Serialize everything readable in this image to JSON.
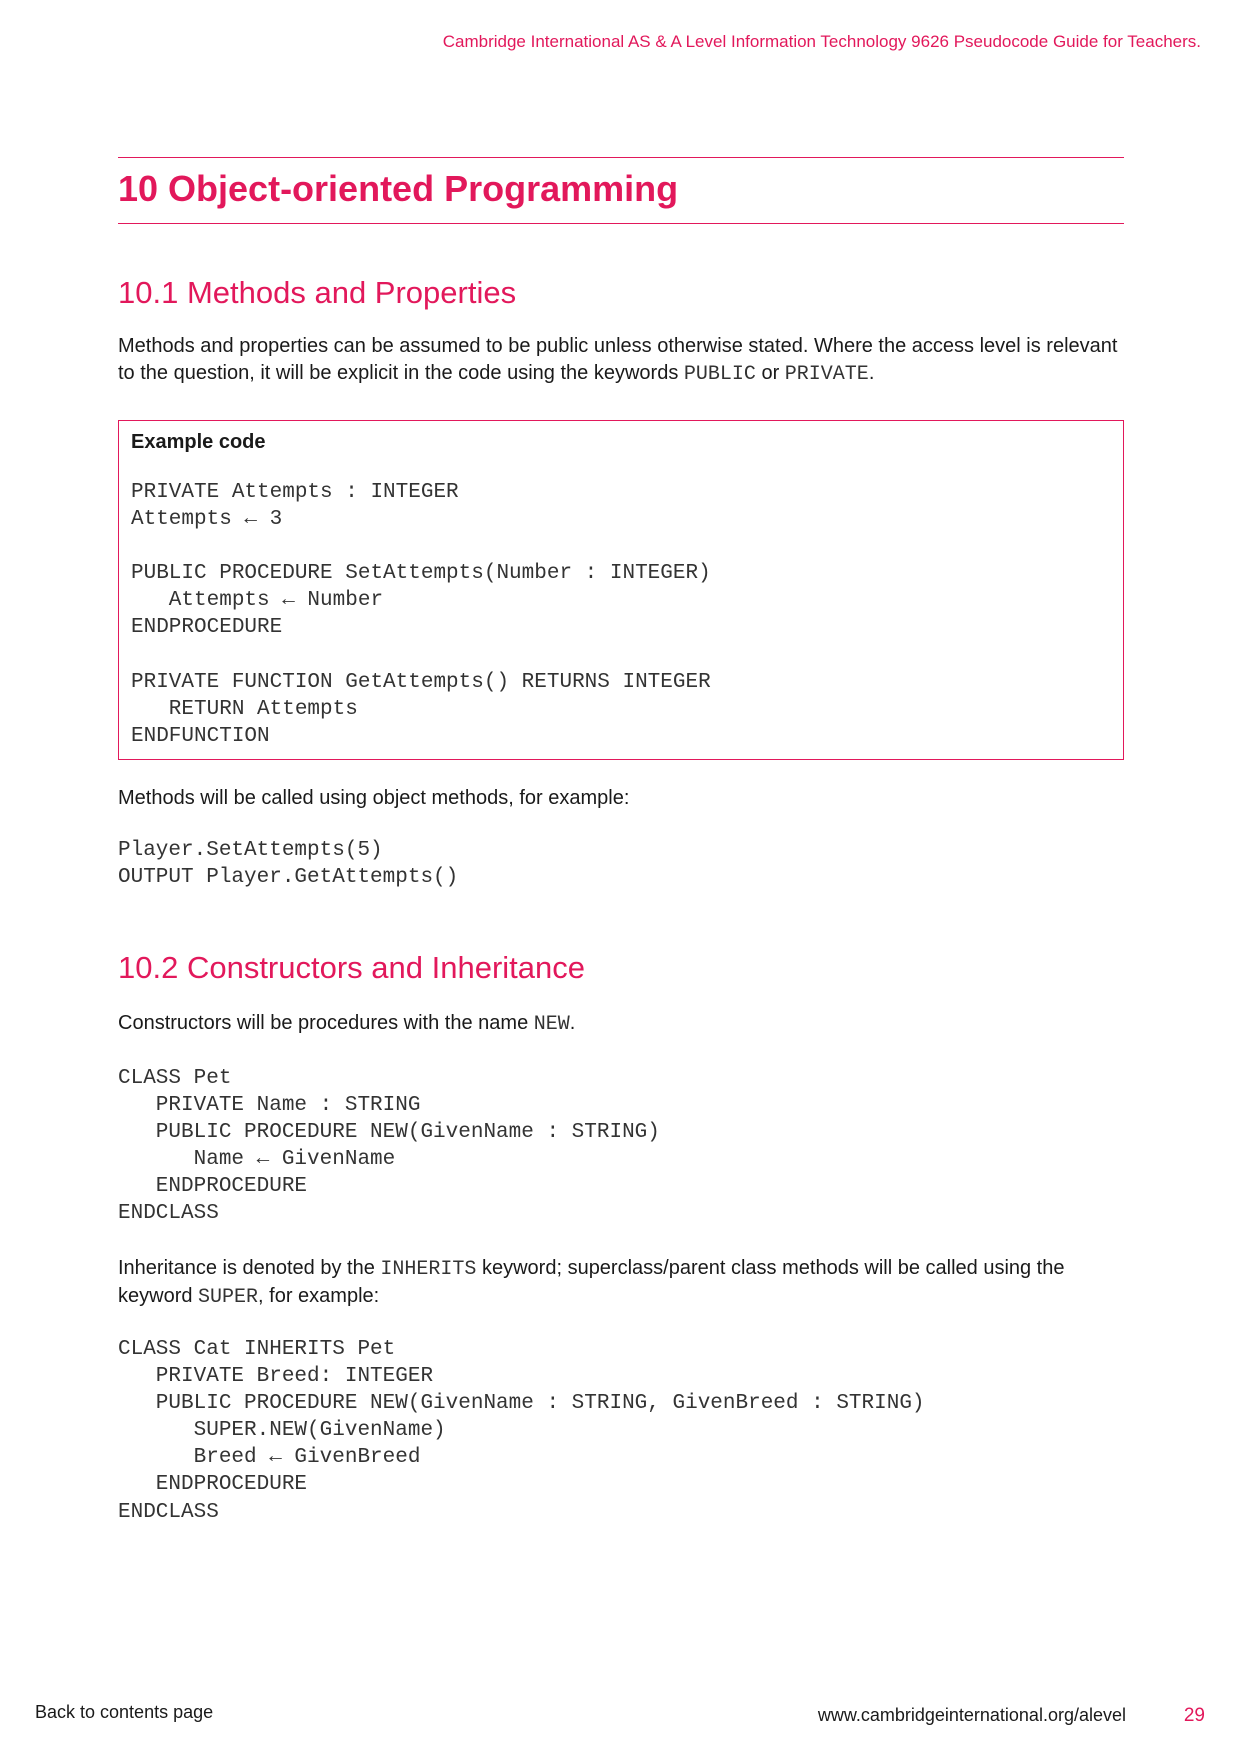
{
  "header": {
    "running_title": "Cambridge International AS & A Level Information Technology 9626 Pseudocode Guide for Teachers."
  },
  "chapter": {
    "title": "10  Object-oriented Programming"
  },
  "section_10_1": {
    "title": "10.1  Methods and Properties",
    "intro_text": "Methods and properties can be assumed to be public unless otherwise stated. Where the access level is relevant to the question, it will be explicit in the code using the keywords ",
    "kw_public": "PUBLIC",
    "text_or": " or ",
    "kw_private": "PRIVATE",
    "text_period": ".",
    "example_box": {
      "title": "Example code",
      "code": "PRIVATE Attempts : INTEGER\nAttempts ← 3\n\nPUBLIC PROCEDURE SetAttempts(Number : INTEGER)\n   Attempts ← Number\nENDPROCEDURE\n\nPRIVATE FUNCTION GetAttempts() RETURNS INTEGER\n   RETURN Attempts\nENDFUNCTION"
    },
    "call_text": "Methods will be called using object methods, for example:",
    "call_code": "Player.SetAttempts(5)\nOUTPUT Player.GetAttempts()"
  },
  "section_10_2": {
    "title": "10.2  Constructors and Inheritance",
    "constructor_text": "Constructors will be procedures with the name ",
    "kw_new": "NEW",
    "constructor_end": ".",
    "pet_code": "CLASS Pet\n   PRIVATE Name : STRING\n   PUBLIC PROCEDURE NEW(GivenName : STRING)\n      Name ← GivenName\n   ENDPROCEDURE\nENDCLASS",
    "inherit_text_1": "Inheritance is denoted by the ",
    "kw_inherits": "INHERITS",
    "inherit_text_2": " keyword; superclass/parent class methods will be called using the keyword ",
    "kw_super": "SUPER",
    "inherit_text_3": ", for example:",
    "cat_code": "CLASS Cat INHERITS Pet\n   PRIVATE Breed: INTEGER\n   PUBLIC PROCEDURE NEW(GivenName : STRING, GivenBreed : STRING)\n      SUPER.NEW(GivenName)\n      Breed ← GivenBreed\n   ENDPROCEDURE\nENDCLASS"
  },
  "footer": {
    "back_link": "Back to contents page",
    "url": "www.cambridgeinternational.org/alevel",
    "page_number": "29"
  },
  "colors": {
    "accent": "#e2185b",
    "text": "#1a1a1a",
    "code_text": "#333333"
  }
}
